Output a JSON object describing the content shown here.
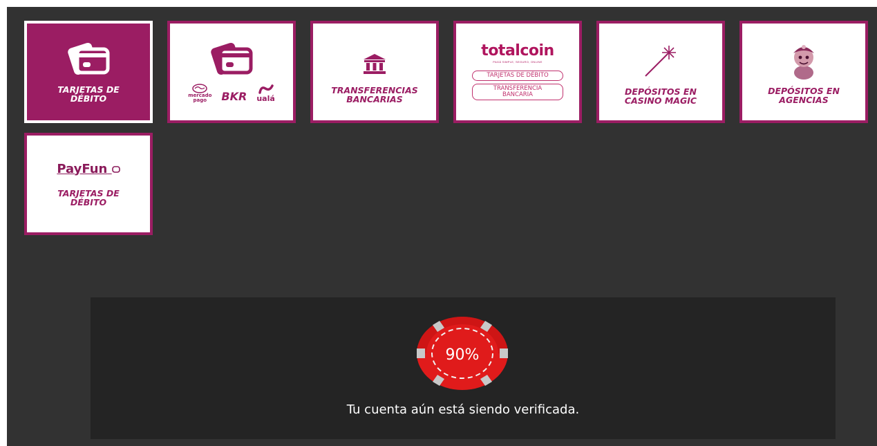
{
  "colors": {
    "background": "#323232",
    "panel": "#242424",
    "tile_border": "#9b1d63",
    "accent": "#b0155e",
    "chip_red": "#e01b1b"
  },
  "payment_methods": [
    {
      "id": "tarjetas-debito",
      "label": "TARJETAS DE\nDÉBITO",
      "icon": "credit-card-icon",
      "selected": true
    },
    {
      "id": "billeteras",
      "icon": "credit-card-icon",
      "logos": {
        "mercadopago": "mercado\npago",
        "bkr": "BKR",
        "uala": "ualá"
      }
    },
    {
      "id": "transferencias",
      "label": "TRANSFERENCIAS\nBANCARIAS",
      "icon": "bank-icon"
    },
    {
      "id": "totalcoin",
      "brand": "totalcoin",
      "tagline": "PAGÁ SIMPLE, SEGURO, ONLINE",
      "pill1": "TARJETAS DE DÉBITO",
      "pill2": "TRANSFERENCIA\nBANCARIA"
    },
    {
      "id": "casino-magic",
      "label": "DEPÓSITOS EN\nCASINO MAGIC",
      "icon": "magic-wand-icon"
    },
    {
      "id": "agencias",
      "label": "DEPÓSITOS EN\nAGENCIAS",
      "icon": "mascot-icon"
    },
    {
      "id": "payfun",
      "brand": "PayFun",
      "label": "TARJETAS DE\nDÉBITO"
    }
  ],
  "verification": {
    "progress_text": "90%",
    "progress": 0.9,
    "message": "Tu cuenta aún está siendo verificada."
  }
}
